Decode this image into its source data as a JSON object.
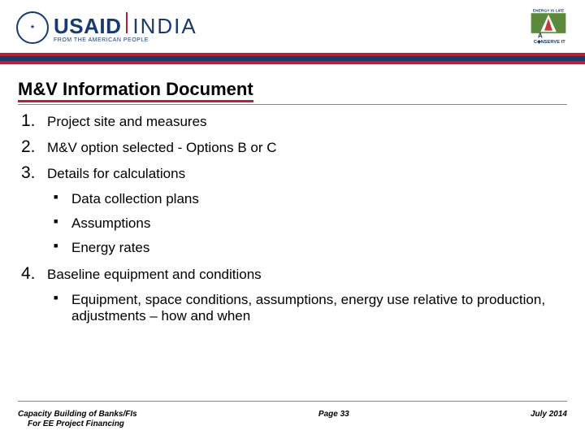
{
  "header": {
    "usaid": "USAID",
    "india": "INDIA",
    "tagline": "FROM THE AMERICAN PEOPLE",
    "right_logo_top": "ENERGY IS LIFE",
    "right_logo_mid": "A",
    "right_logo_bottom": "C♦NSERVE IT"
  },
  "title": "M&V Information Document",
  "list": [
    {
      "num": "1.",
      "text": "Project site and measures",
      "sub": []
    },
    {
      "num": "2.",
      "text": "M&V option selected - Options B or C",
      "sub": []
    },
    {
      "num": "3.",
      "text": "Details for calculations",
      "sub": [
        "Data collection plans",
        "Assumptions",
        "Energy rates"
      ]
    },
    {
      "num": "4.",
      "text": "Baseline equipment and conditions",
      "sub": [
        "Equipment, space conditions, assumptions, energy use relative to production, adjustments – how and when"
      ]
    }
  ],
  "footer": {
    "left_line1": "Capacity Building of Banks/FIs",
    "left_line2": "For EE Project Financing",
    "center": "Page 33",
    "right": "July 2014"
  }
}
